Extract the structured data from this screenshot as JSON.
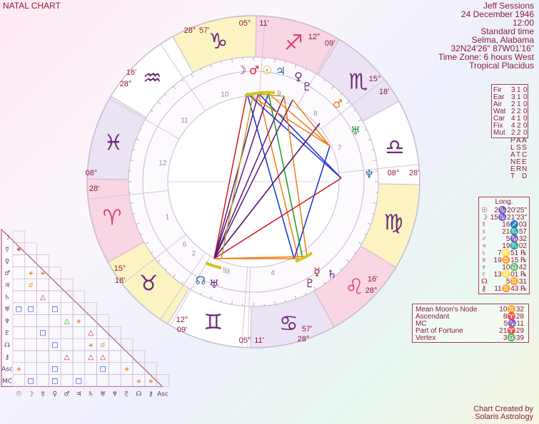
{
  "title": "NATAL CHART",
  "person": {
    "name": "Jeff Sessions",
    "date": "24 December 1946",
    "time": "12:00",
    "time_type": "Standard time",
    "place": "Selma, Alabama",
    "coords": "32N24'26\"  87W01'16\"",
    "timezone": "Time Zone: 6 hours West",
    "system": "Tropical Placidus"
  },
  "colors": {
    "title_text": "#8b1c3c",
    "ring_fire_red": "#f8d6e3",
    "ring_yellow": "#fbf3c1",
    "ring_purple": "#ece3f5",
    "aspect_red": "#d41818",
    "aspect_blue": "#1a2fd4",
    "aspect_green": "#1a9a1a",
    "aspect_orange": "#f07c12",
    "aspect_purple": "#5a1a7a"
  },
  "signs": [
    {
      "name": "capricorn",
      "glyph": "♑",
      "color": "#6b2a7a"
    },
    {
      "name": "sagittarius",
      "glyph": "♐",
      "color": "#e0427a"
    },
    {
      "name": "scorpio",
      "glyph": "♏",
      "color": "#6b2a7a"
    },
    {
      "name": "libra",
      "glyph": "♎",
      "color": "#6b2a7a"
    },
    {
      "name": "virgo",
      "glyph": "♍",
      "color": "#6b2a7a"
    },
    {
      "name": "leo",
      "glyph": "♌",
      "color": "#e0427a"
    },
    {
      "name": "cancer",
      "glyph": "♋",
      "color": "#6b2a7a"
    },
    {
      "name": "gemini",
      "glyph": "♊",
      "color": "#6b2a7a"
    },
    {
      "name": "taurus",
      "glyph": "♉",
      "color": "#6b2a7a"
    },
    {
      "name": "aries",
      "glyph": "♈",
      "color": "#e0427a"
    },
    {
      "name": "pisces",
      "glyph": "♓",
      "color": "#6b2a7a"
    },
    {
      "name": "aquarius",
      "glyph": "♒",
      "color": "#6b2a7a"
    }
  ],
  "cusp_labels": [
    {
      "deg": "05°",
      "min": "11'"
    },
    {
      "deg": "12°",
      "min": "09'"
    },
    {
      "deg": "15°",
      "min": "18'"
    },
    {
      "deg": "08°",
      "min": "28'"
    },
    {
      "deg": "16'",
      "min": "28°"
    },
    {
      "deg": "57'",
      "min": "28°"
    },
    {
      "deg": "05°",
      "min": "11'"
    },
    {
      "deg": "12°",
      "min": "09'"
    },
    {
      "deg": "15°",
      "min": "18'"
    },
    {
      "deg": "08°",
      "min": "28'"
    },
    {
      "deg": "16'",
      "min": "28°"
    },
    {
      "deg": "28°",
      "min": "57'"
    }
  ],
  "house_numbers": [
    "1",
    "2",
    "3",
    "4",
    "5",
    "6",
    "7",
    "8",
    "9",
    "10",
    "11",
    "12"
  ],
  "planets_on_wheel": [
    {
      "glyph": "☽",
      "color": "#6b2a7a"
    },
    {
      "glyph": "♂",
      "color": "#d42020"
    },
    {
      "glyph": "☉",
      "color": "#e0b000"
    },
    {
      "glyph": "♃",
      "color": "#2a6aa0"
    },
    {
      "glyph": "♀",
      "color": "#6b2a7a"
    },
    {
      "glyph": "♇",
      "color": "#6b2a7a"
    },
    {
      "glyph": "♂",
      "color": "#e07a1a"
    },
    {
      "glyph": "♅",
      "color": "#2a8a4a"
    },
    {
      "glyph": "♆",
      "color": "#2a6aa0"
    },
    {
      "glyph": "☿",
      "color": "#8b1c3c"
    },
    {
      "glyph": "♄",
      "color": "#6b2a7a"
    },
    {
      "glyph": "♇",
      "color": "#6b2a7a"
    },
    {
      "glyph": "☊",
      "color": "#2a6aa0"
    },
    {
      "glyph": "♅",
      "color": "#6b2a7a"
    }
  ],
  "elements": {
    "rows": [
      {
        "label": "Fir",
        "a": "3",
        "b": "1",
        "c": "0"
      },
      {
        "label": "Ear",
        "a": "3",
        "b": "1",
        "c": "0"
      },
      {
        "label": "Air",
        "a": "2",
        "b": "1",
        "c": "0"
      },
      {
        "label": "Wat",
        "a": "2",
        "b": "2",
        "c": "0"
      },
      {
        "label": "Car",
        "a": "4",
        "b": "1",
        "c": "0"
      },
      {
        "label": "Fix",
        "a": "4",
        "b": "2",
        "c": "0"
      },
      {
        "label": "Mut",
        "a": "2",
        "b": "2",
        "c": "0"
      }
    ],
    "vertical": [
      "PLANET",
      "ASTER",
      "ASCEND"
    ]
  },
  "longitudes": {
    "header": "Long.",
    "rows": [
      {
        "g": "☉",
        "v": "2♑20'25\""
      },
      {
        "g": "☽",
        "v": "15♑21'23\""
      },
      {
        "g": "☿",
        "v": "16♐03"
      },
      {
        "g": "♀",
        "v": "21♏57"
      },
      {
        "g": "♂",
        "v": "5♑32"
      },
      {
        "g": "♃",
        "v": "19♏02"
      },
      {
        "g": "♄",
        "v": "7♌51 ℞"
      },
      {
        "g": "♅",
        "v": "19♊15 ℞"
      },
      {
        "g": "♆",
        "v": "10♎42"
      },
      {
        "g": "♇",
        "v": "13♌01 ℞"
      },
      {
        "g": "☊",
        "v": "5♊31"
      },
      {
        "g": "⚷",
        "v": "11♊43 ℞"
      }
    ]
  },
  "points": [
    {
      "label": "Mean Moon's Node",
      "v": "10♊32"
    },
    {
      "label": "Ascendant",
      "v": "8♈28"
    },
    {
      "label": "MC",
      "v": "5♑11"
    },
    {
      "label": "Part of Fortune",
      "v": "21♈29"
    },
    {
      "label": "Vertex",
      "v": "3♎39"
    }
  ],
  "aspect_grid": {
    "row_glyphs": [
      "☽",
      "☿",
      "♀",
      "♂",
      "♃",
      "♄",
      "♅",
      "♆",
      "♇",
      "☊",
      "⚷",
      "Asc",
      "MC"
    ],
    "col_glyphs": [
      "☉",
      "☽",
      "☿",
      "♀",
      "♂",
      "♃",
      "♄",
      "♅",
      "♆",
      "♇",
      "☊",
      "⚷",
      "Asc"
    ]
  },
  "credits": {
    "line1": "Chart Created by",
    "line2": "Solaris Astrology"
  }
}
